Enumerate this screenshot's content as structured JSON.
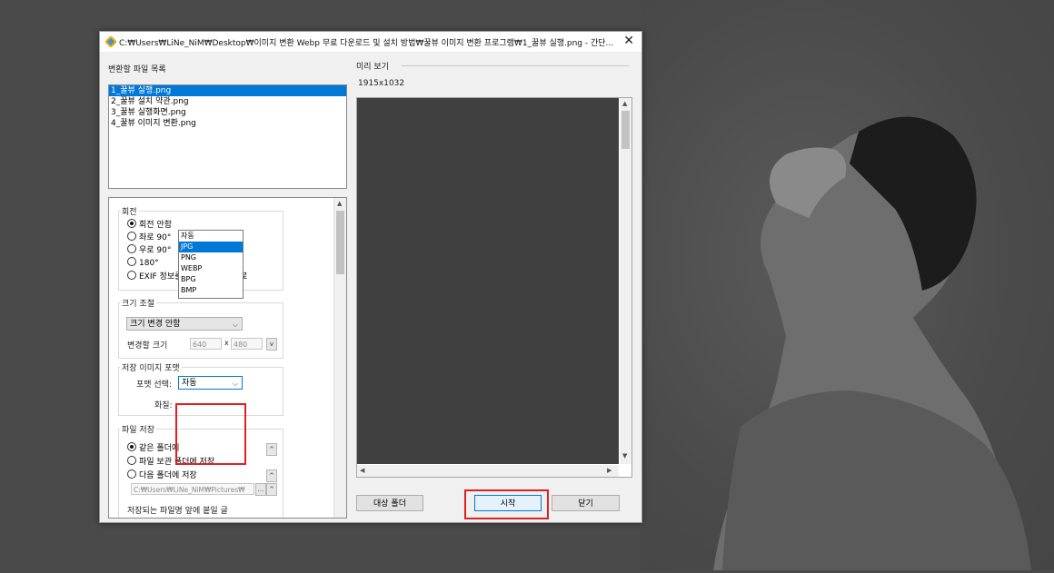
{
  "window": {
    "title": "C:₩Users₩LiNe_NiM₩Desktop₩이미지 변환 Webp 무료 다운로드 및 설치 방법₩꿀뷰 이미지 변환 프로그램₩1_꿀뷰 실행.png - 간단...",
    "close": "✕"
  },
  "file_list": {
    "label": "변환할 파일 목록",
    "items": [
      "1_꿀뷰 실행.png",
      "2_꿀뷰 설치 약관.png",
      "3_꿀뷰 실행화면.png",
      "4_꿀뷰 이미지 변환.png"
    ],
    "selected_index": 0
  },
  "rotation": {
    "title": "회전",
    "options": [
      "회전 안함",
      "좌로 90°",
      "우로 90°",
      "180°",
      "EXIF 정보를 사용해서 자동으로"
    ],
    "selected_index": 0
  },
  "resize": {
    "title": "크기 조절",
    "mode_value": "크기 변경 안함",
    "size_label": "변경할 크기",
    "width": "640",
    "separator": "x",
    "height": "480",
    "btn": "v"
  },
  "format": {
    "title": "저장 이미지 포맷",
    "select_label": "포맷 선택:",
    "value": "자동",
    "quality_label": "화질:",
    "options": [
      "자동",
      "JPG",
      "PNG",
      "WEBP",
      "BPG",
      "BMP"
    ],
    "highlighted_index": 1
  },
  "save": {
    "title": "파일 저장",
    "options": [
      "같은 폴더에",
      "파일 보관 폴더에 저장",
      "다음 폴더에 저장"
    ],
    "selected_index": 0,
    "path": "C:₩Users₩LiNe_NiM₩Pictures₩",
    "browse": "...",
    "prefix_label": "저장되는 파일명 앞에 붙일 글"
  },
  "preview": {
    "label": "미리 보기",
    "dims": "1915x1032"
  },
  "buttons": {
    "target_folder": "대상 폴더",
    "start": "시작",
    "close": "닫기"
  },
  "colors": {
    "selection": "#0078d7",
    "highlight_box": "#e02020",
    "background": "#4a4a4a"
  }
}
